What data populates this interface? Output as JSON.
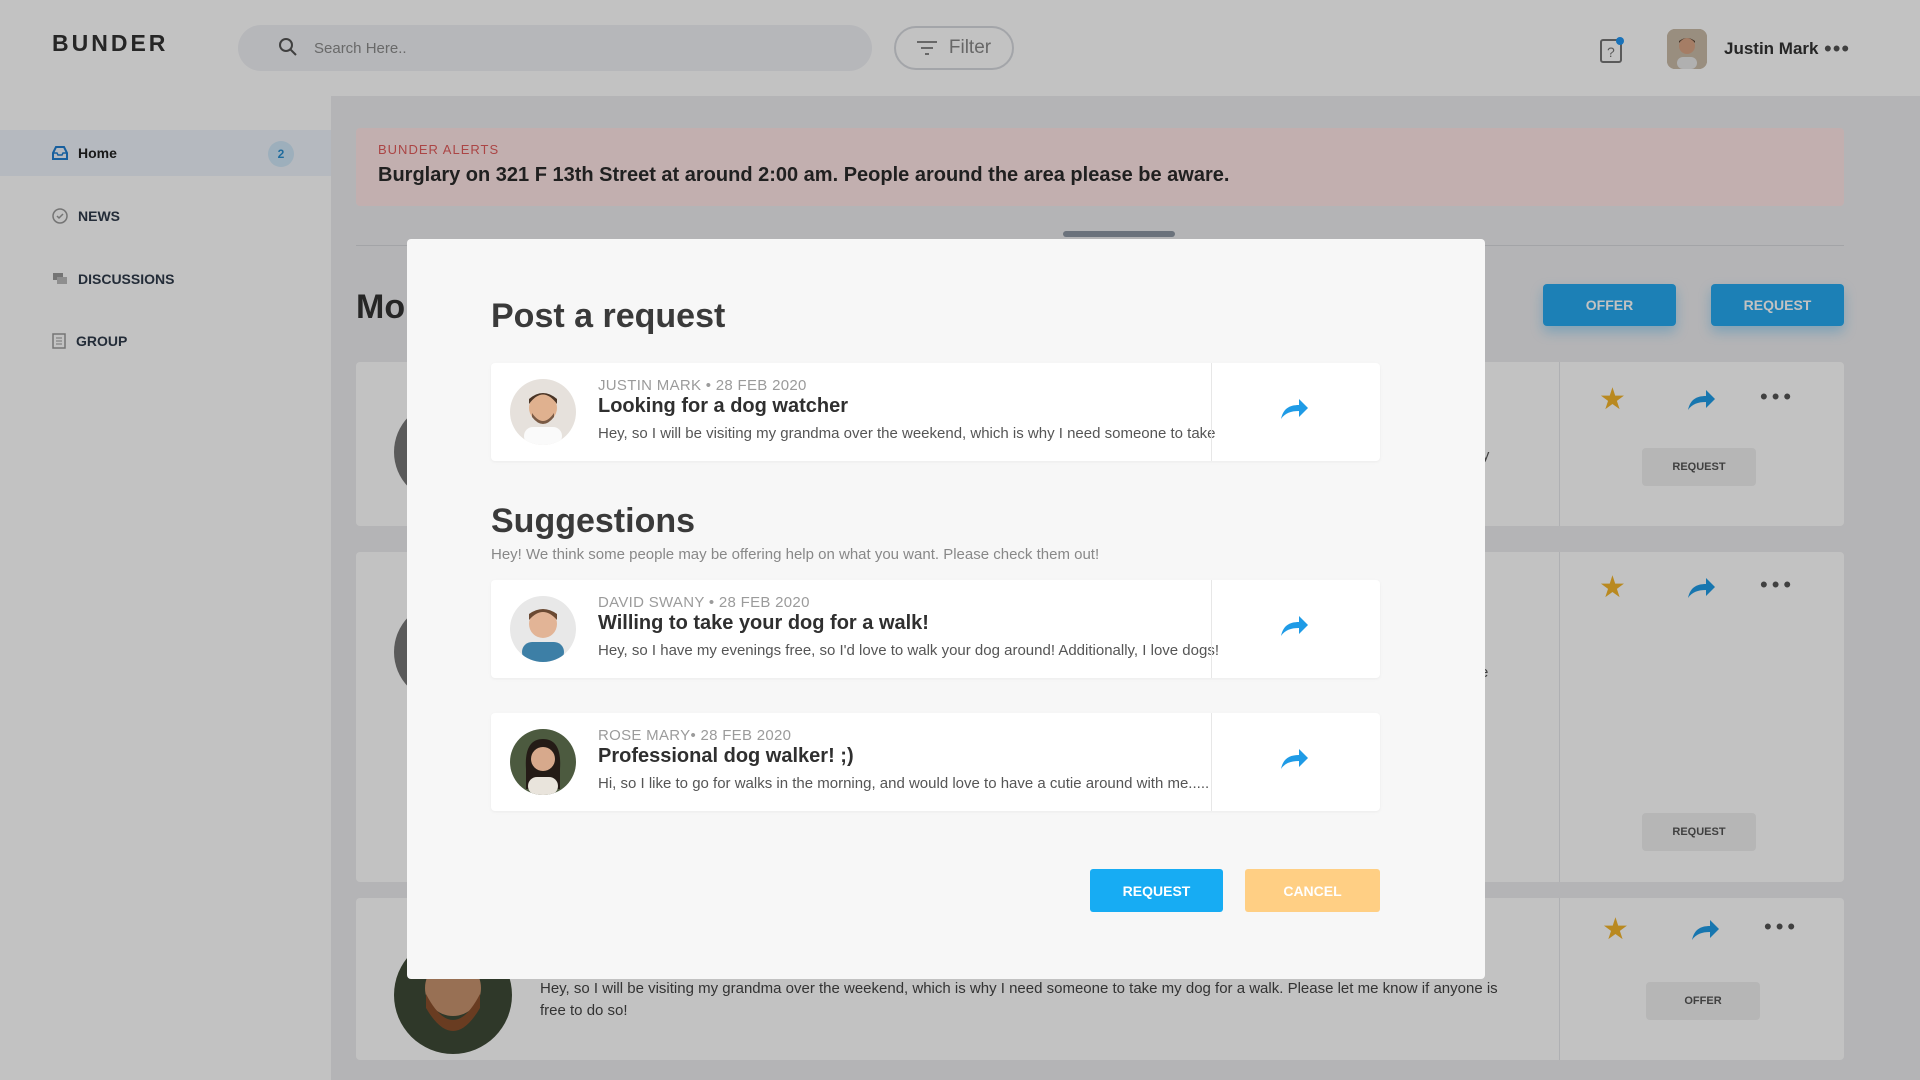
{
  "app": {
    "logo": "BUNDER"
  },
  "search": {
    "placeholder": "Search Here.."
  },
  "filter": {
    "label": "Filter"
  },
  "user": {
    "name": "Justin Mark"
  },
  "sidebar": {
    "items": [
      {
        "label": "Home",
        "badge": "2"
      },
      {
        "label": "NEWS"
      },
      {
        "label": "DISCUSSIONS"
      },
      {
        "label": "GROUP"
      }
    ]
  },
  "alert": {
    "label": "BUNDER ALERTS",
    "text": "Burglary on 321 F 13th Street at around 2:00 am. People around the area please be aware."
  },
  "main": {
    "section_title": "Mo",
    "offer_label": "OFFER",
    "request_label": "REQUEST",
    "cards": [
      {
        "button": "REQUEST",
        "partial": "nity"
      },
      {
        "button": "REQUEST",
        "partial": "e"
      },
      {
        "button": "OFFER",
        "text": "Hey, so I will be visiting my grandma over the weekend, which is why I need someone to take my dog for a walk. Please let me know if anyone is free to do so!"
      }
    ]
  },
  "modal": {
    "title": "Post a request",
    "post": {
      "meta": "JUSTIN MARK • 28 FEB 2020",
      "title": "Looking for a dog watcher",
      "desc": "Hey, so I will be visiting my grandma over the weekend, which is why I need someone to take"
    },
    "suggestions_title": "Suggestions",
    "suggestions_sub": "Hey! We think some people may be offering help on what you want. Please check them out!",
    "suggestions": [
      {
        "meta": "DAVID SWANY • 28 FEB 2020",
        "title": "Willing to take your dog for a walk!",
        "desc": "Hey, so I have my evenings free, so I'd love to walk your dog around! Additionally, I love dogs!"
      },
      {
        "meta": "ROSE MARY• 28 FEB 2020",
        "title": "Professional dog walker! ;)",
        "desc": "Hi, so I like to go for walks in the morning, and would love to have a cutie around with me....."
      }
    ],
    "request_label": "REQUEST",
    "cancel_label": "CANCEL"
  },
  "colors": {
    "accent": "#17acf3",
    "cancel": "#ffcf84",
    "alert_bg": "#ffe7e7",
    "alert_label": "#e15b5b",
    "star": "#f3b52b"
  }
}
